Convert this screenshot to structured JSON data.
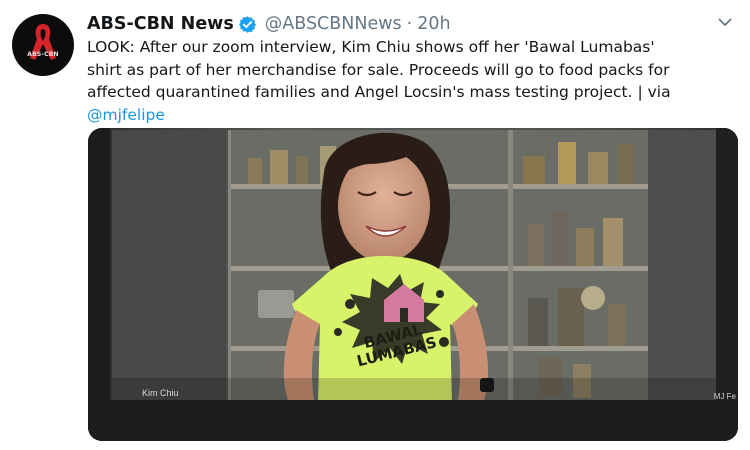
{
  "tweet": {
    "display_name": "ABS-CBN News",
    "handle": "@ABSCBNNews",
    "separator": "·",
    "time": "20h",
    "avatar_text": "ABS-CBN",
    "text_lines": [
      "LOOK: After our zoom interview, Kim Chiu shows off her 'Bawal Lumabas'",
      "shirt as part of her merchandise for sale. Proceeds will go to food packs for",
      "affected quarantined families and Angel Locsin's mass testing project. | via"
    ],
    "mention": "@mjfelipe"
  },
  "media": {
    "shirt_text_line1": "BAWAL",
    "shirt_text_line2": "LUMABAS",
    "caption_left": "Kim Chiu",
    "caption_right": "MJ Fe"
  },
  "colors": {
    "verified": "#1da1f2",
    "link": "#1b95e0",
    "shirt": "#d8f26a"
  },
  "icons": [
    "verified-badge-icon",
    "chevron-down-icon",
    "ribbon-logo-icon"
  ]
}
